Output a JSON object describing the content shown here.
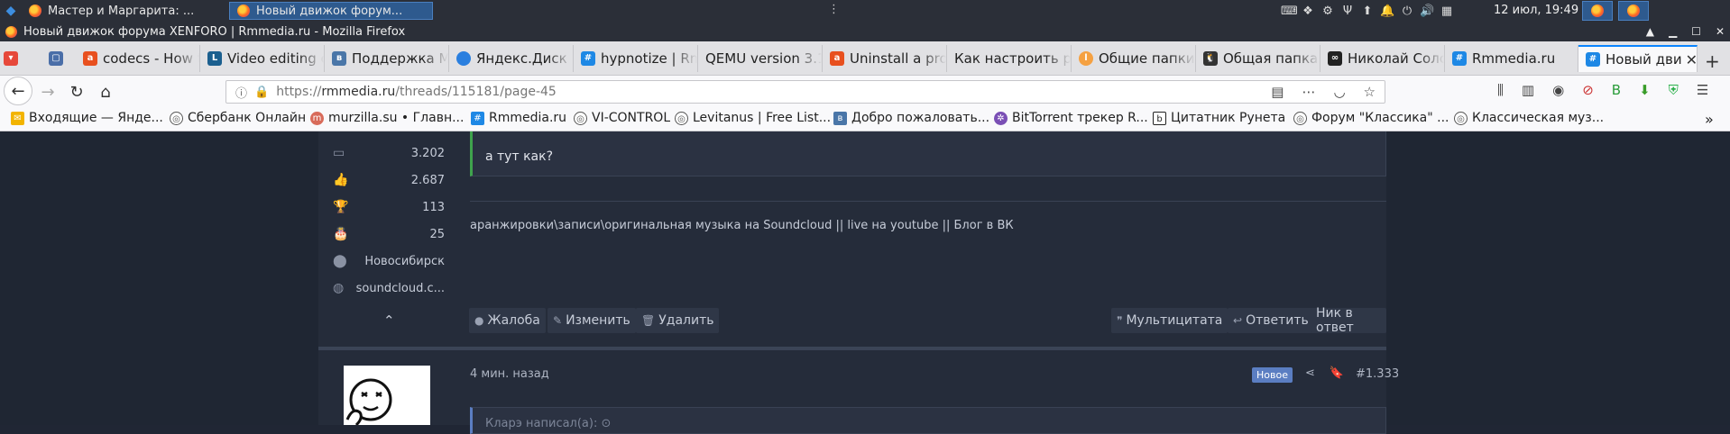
{
  "system_bar": {
    "tasks": [
      {
        "label": "Мастер и Маргарита: ..."
      },
      {
        "label": "Новый движок форум..."
      }
    ],
    "drag_glyph": "⋮",
    "clock": "12 июл, 19:49"
  },
  "window": {
    "title": "Новый движок форума XENFORO | Rmmedia.ru - Mozilla Firefox"
  },
  "tabs": [
    {
      "label": "codecs - How t",
      "icon": "ask-icon",
      "color": "#e8501f"
    },
    {
      "label": "Video editing c",
      "icon": "lyrics-icon",
      "color": "#1b5f8f"
    },
    {
      "label": "Поддержка М",
      "icon": "vk-icon",
      "color": "#4a76a8"
    },
    {
      "label": "Яндекс.Диск",
      "icon": "disk-icon",
      "color": "#2a7fdf"
    },
    {
      "label": "hypnotize | Rm",
      "icon": "rmmedia-icon",
      "color": "#1e88e5"
    },
    {
      "label": "QEMU version 3.1",
      "icon": "none",
      "color": "#bbbbbb"
    },
    {
      "label": "Uninstall a pro",
      "icon": "ask-icon",
      "color": "#e8501f"
    },
    {
      "label": "Как настроить р",
      "icon": "none",
      "color": "#bbbbbb"
    },
    {
      "label": "Общие папки",
      "icon": "lt-icon",
      "color": "#f5a142"
    },
    {
      "label": "Общая папка",
      "icon": "linux-icon",
      "color": "#333333"
    },
    {
      "label": "Николай Солс",
      "icon": "cp-icon",
      "color": "#222222"
    },
    {
      "label": "Rmmedia.ru",
      "icon": "rmmedia-icon",
      "color": "#1e88e5"
    },
    {
      "label": "Новый дви",
      "icon": "rmmedia-icon",
      "color": "#1e88e5"
    }
  ],
  "navbar": {
    "url_prefix": "https://",
    "url_host": "rmmedia.ru",
    "url_path": "/threads/115181/page-45"
  },
  "bookmarks": [
    {
      "label": "Входящие — Янде...",
      "icon": "mail-icon"
    },
    {
      "label": "Сбербанк Онлайн",
      "icon": "globe-icon"
    },
    {
      "label": "murzilla.su • Главн...",
      "icon": "murzilla-icon"
    },
    {
      "label": "Rmmedia.ru",
      "icon": "rmmedia-icon"
    },
    {
      "label": "VI-CONTROL",
      "icon": "globe-icon"
    },
    {
      "label": "Levitanus | Free List...",
      "icon": "globe-icon"
    },
    {
      "label": "Добро пожаловать...",
      "icon": "vk-icon"
    },
    {
      "label": "BitTorrent трекер R...",
      "icon": "rutracker-icon"
    },
    {
      "label": "Цитатник Рунета",
      "icon": "bash-icon"
    },
    {
      "label": "Форум \"Классика\" ...",
      "icon": "globe-icon"
    },
    {
      "label": "Классическая муз...",
      "icon": "globe-icon"
    }
  ],
  "post_prev": {
    "stats": [
      {
        "icon": "messages-icon",
        "value": "3.202"
      },
      {
        "icon": "likes-icon",
        "value": "2.687"
      },
      {
        "icon": "trophy-icon",
        "value": "113"
      },
      {
        "icon": "cake-icon",
        "value": "25"
      },
      {
        "icon": "location-icon",
        "value": "Новосибирск"
      },
      {
        "icon": "website-icon",
        "value": "soundcloud.c..."
      }
    ],
    "quote_text": "а тут как?",
    "signature": "аранжировки\\записи\\оригинальная музыка на Soundcloud || live на youtube || Блог в ВК",
    "actions_left": [
      "Жалоба",
      "Изменить",
      "Удалить"
    ],
    "actions_right": [
      "Мультицитата",
      "Ответить",
      "Ник в ответ"
    ]
  },
  "post_next": {
    "time": "4 мин. назад",
    "badge": "Новое",
    "number": "#1.333",
    "quote_header": "Кларэ написал(а): ⊙"
  }
}
